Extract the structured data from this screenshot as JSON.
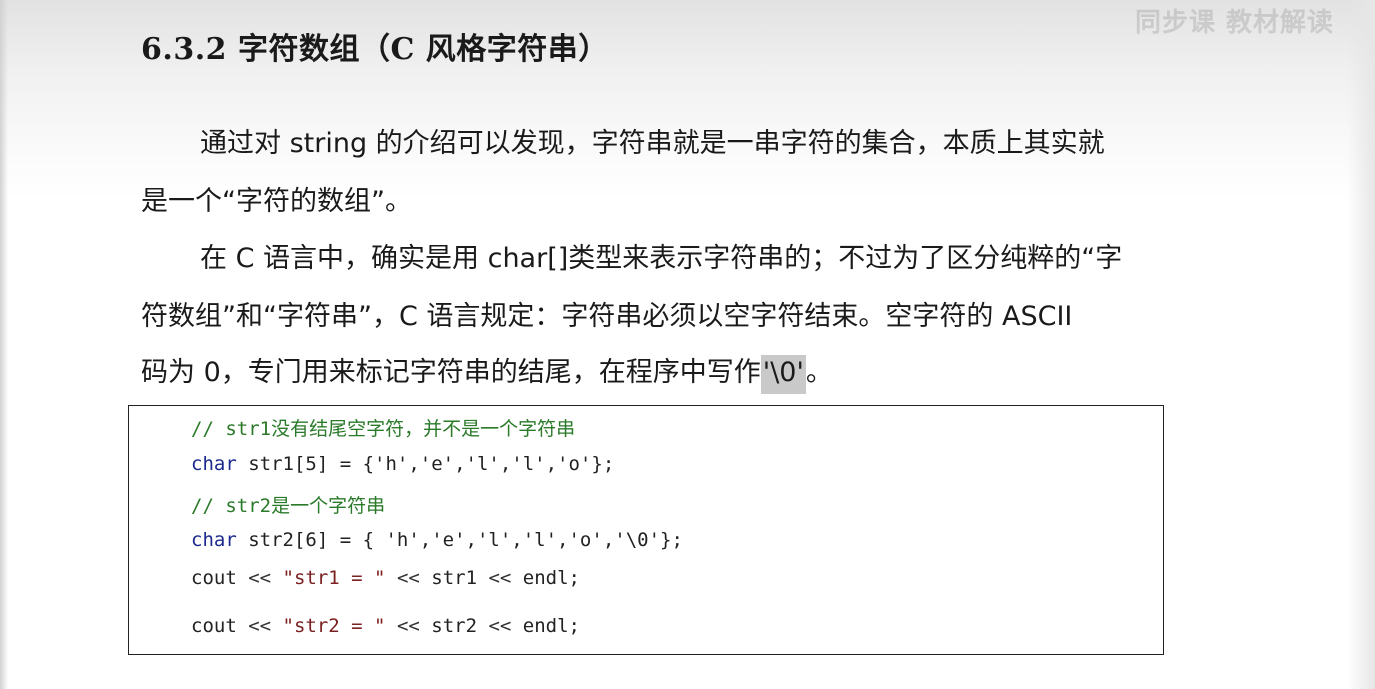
{
  "watermark": "同步课  教材解读",
  "heading": "6.3.2  字符数组（C 风格字符串）",
  "paragraph": {
    "line1": "通过对 string 的介绍可以发现，字符串就是一串字符的集合，本质上其实就",
    "line2": "是一个“字符的数组”。",
    "line3": "在 C 语言中，确实是用 char[]类型来表示字符串的；不过为了区分纯粹的“字",
    "line4": "符数组”和“字符串”，C 语言规定：字符串必须以空字符结束。空字符的 ASCII",
    "line5_before": "码为 0，专门用来标记字符串的结尾，在程序中写作",
    "line5_highlight": "'\\0'",
    "line5_after": "。"
  },
  "code": {
    "comment1": "// str1没有结尾空字符，并不是一个字符串",
    "line2_kw": "char",
    "line2_rest": " str1[5] = {'h','e','l','l','o'};",
    "comment2": "// str2是一个字符串",
    "line4_kw": "char",
    "line4_rest": " str2[6] = { 'h','e','l','l','o','\\0'};",
    "line5_a": "cout ",
    "line5_op1": "<<",
    "line5_str": " \"str1 = \" ",
    "line5_op2": "<<",
    "line5_b": " str1 ",
    "line5_op3": "<<",
    "line5_c": " endl;",
    "line6_a": "cout ",
    "line6_op1": "<<",
    "line6_str": " \"str2 = \" ",
    "line6_op2": "<<",
    "line6_b": " str2 ",
    "line6_op3": "<<",
    "line6_c": " endl;"
  },
  "colors": {
    "comment": "#2a7a2a",
    "keyword": "#1c2a8f",
    "string": "#7a2020",
    "highlight": "#c9c9c9"
  }
}
